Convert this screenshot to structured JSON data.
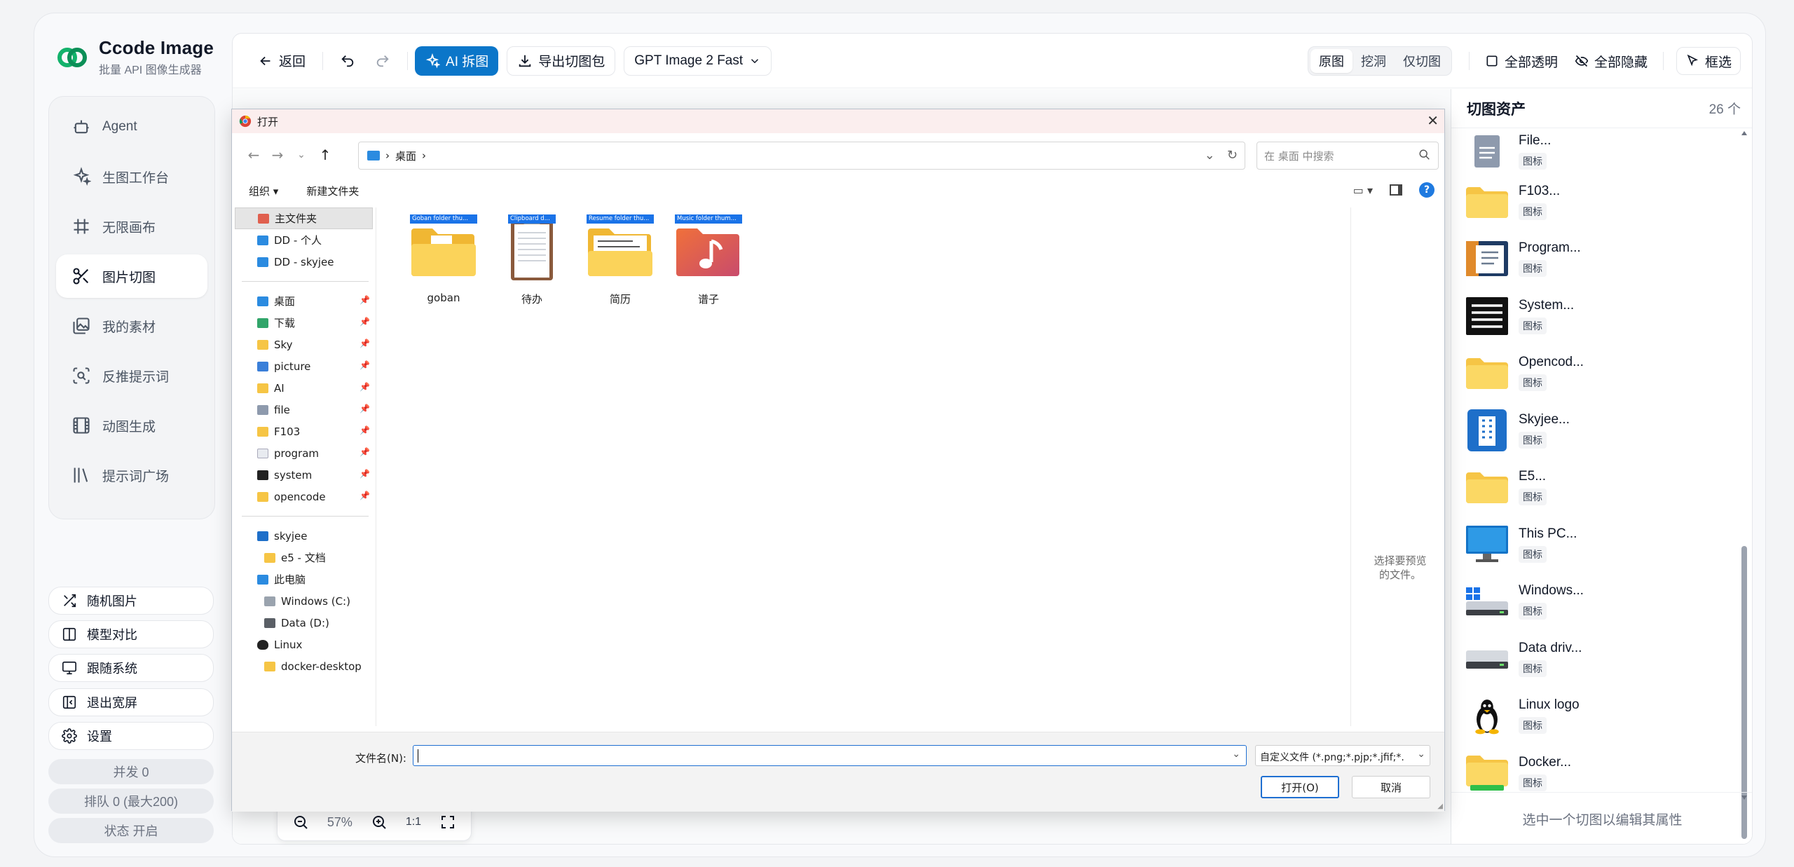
{
  "brand": {
    "title": "Ccode Image",
    "subtitle": "批量 API 图像生成器"
  },
  "nav": [
    {
      "label": "Agent",
      "icon": "bot-icon"
    },
    {
      "label": "生图工作台",
      "icon": "sparkles-icon"
    },
    {
      "label": "无限画布",
      "icon": "grid-hash-icon"
    },
    {
      "label": "图片切图",
      "icon": "scissors-icon",
      "active": true
    },
    {
      "label": "我的素材",
      "icon": "images-icon"
    },
    {
      "label": "反推提示词",
      "icon": "scan-search-icon"
    },
    {
      "label": "动图生成",
      "icon": "film-icon"
    },
    {
      "label": "提示词广场",
      "icon": "library-icon"
    }
  ],
  "bottom_buttons": [
    {
      "label": "随机图片",
      "icon": "shuffle-icon"
    },
    {
      "label": "模型对比",
      "icon": "columns-icon"
    },
    {
      "label": "跟随系统",
      "icon": "monitor-icon"
    },
    {
      "label": "退出宽屏",
      "icon": "panel-left-icon"
    },
    {
      "label": "设置",
      "icon": "gear-icon"
    }
  ],
  "status": {
    "concurrency": "并发 0",
    "queue": "排队 0 (最大200)",
    "state": "状态 开启"
  },
  "toolbar": {
    "back": "返回",
    "ai_split": "AI 拆图",
    "export": "导出切图包",
    "model": "GPT Image 2 Fast",
    "modes": [
      "原图",
      "挖洞",
      "仅切图"
    ],
    "active_mode": "原图",
    "all_transparent": "全部透明",
    "all_hidden": "全部隐藏",
    "select": "框选"
  },
  "assets": {
    "title": "切图资产",
    "count": "26 个",
    "tag": "图标",
    "items": [
      {
        "name": "File...",
        "icon": "document-icon"
      },
      {
        "name": "F103...",
        "icon": "folder-icon"
      },
      {
        "name": "Program...",
        "icon": "program-window-icon"
      },
      {
        "name": "System...",
        "icon": "system-list-icon"
      },
      {
        "name": "Opencod...",
        "icon": "folder-icon"
      },
      {
        "name": "Skyjee...",
        "icon": "building-icon"
      },
      {
        "name": "E5...",
        "icon": "folder-icon"
      },
      {
        "name": "This PC...",
        "icon": "monitor-icon"
      },
      {
        "name": "Windows...",
        "icon": "windows-drive-icon"
      },
      {
        "name": "Data driv...",
        "icon": "drive-icon"
      },
      {
        "name": "Linux logo",
        "icon": "linux-penguin-icon"
      },
      {
        "name": "Docker...",
        "icon": "folder-green-icon"
      }
    ],
    "footer": "选中一个切图以编辑其属性"
  },
  "dialog": {
    "title": "打开",
    "breadcrumb": [
      "桌面"
    ],
    "search_placeholder": "在 桌面 中搜索",
    "organize": "组织 ▾",
    "new_folder": "新建文件夹",
    "tree": [
      {
        "label": "主文件夹",
        "tag": "H",
        "selected": true
      },
      {
        "label": "DD - 个人",
        "tag": "D"
      },
      {
        "label": "DD - skyjee",
        "tag": "D"
      }
    ],
    "quick_access": [
      {
        "label": "桌面",
        "tag": "D"
      },
      {
        "label": "下载",
        "tag": "D"
      },
      {
        "label": "Sky",
        "tag": "S"
      },
      {
        "label": "picture",
        "tag": "P"
      },
      {
        "label": "AI",
        "tag": "A"
      },
      {
        "label": "file",
        "tag": "F"
      },
      {
        "label": "F103",
        "tag": "F"
      },
      {
        "label": "program",
        "tag": "P"
      },
      {
        "label": "system",
        "tag": "S"
      },
      {
        "label": "opencode",
        "tag": "O"
      }
    ],
    "locations": [
      {
        "label": "skyjee",
        "tag": "S",
        "sub": false
      },
      {
        "label": "e5 - 文档",
        "tag": "E",
        "sub": true
      },
      {
        "label": "此电脑",
        "tag": "T",
        "sub": false
      },
      {
        "label": "Windows (C:)",
        "tag": "W",
        "sub": true
      },
      {
        "label": "Data (D:)",
        "tag": "D",
        "sub": true
      },
      {
        "label": "Linux",
        "tag": "L",
        "sub": false
      },
      {
        "label": "docker-desktop",
        "tag": "D",
        "sub": true
      }
    ],
    "files": [
      {
        "name": "goban",
        "badge": "Goban folder thu..."
      },
      {
        "name": "待办",
        "badge": "Clipboard d..."
      },
      {
        "name": "简历",
        "badge": "Resume folder thu..."
      },
      {
        "name": "谱子",
        "badge": "Music folder thum..."
      }
    ],
    "preview_msg": "选择要预览的文件。",
    "filename_label": "文件名(N):",
    "filetype": "自定义文件 (*.png;*.pjp;*.jfif;*.",
    "open": "打开(O)",
    "cancel": "取消"
  },
  "zoom": {
    "level": "57%",
    "reset": "1:1"
  },
  "colors": {
    "primary": "#0b76c9",
    "folder": "#f6c545",
    "dialog_title_bg": "#fbeeee"
  }
}
